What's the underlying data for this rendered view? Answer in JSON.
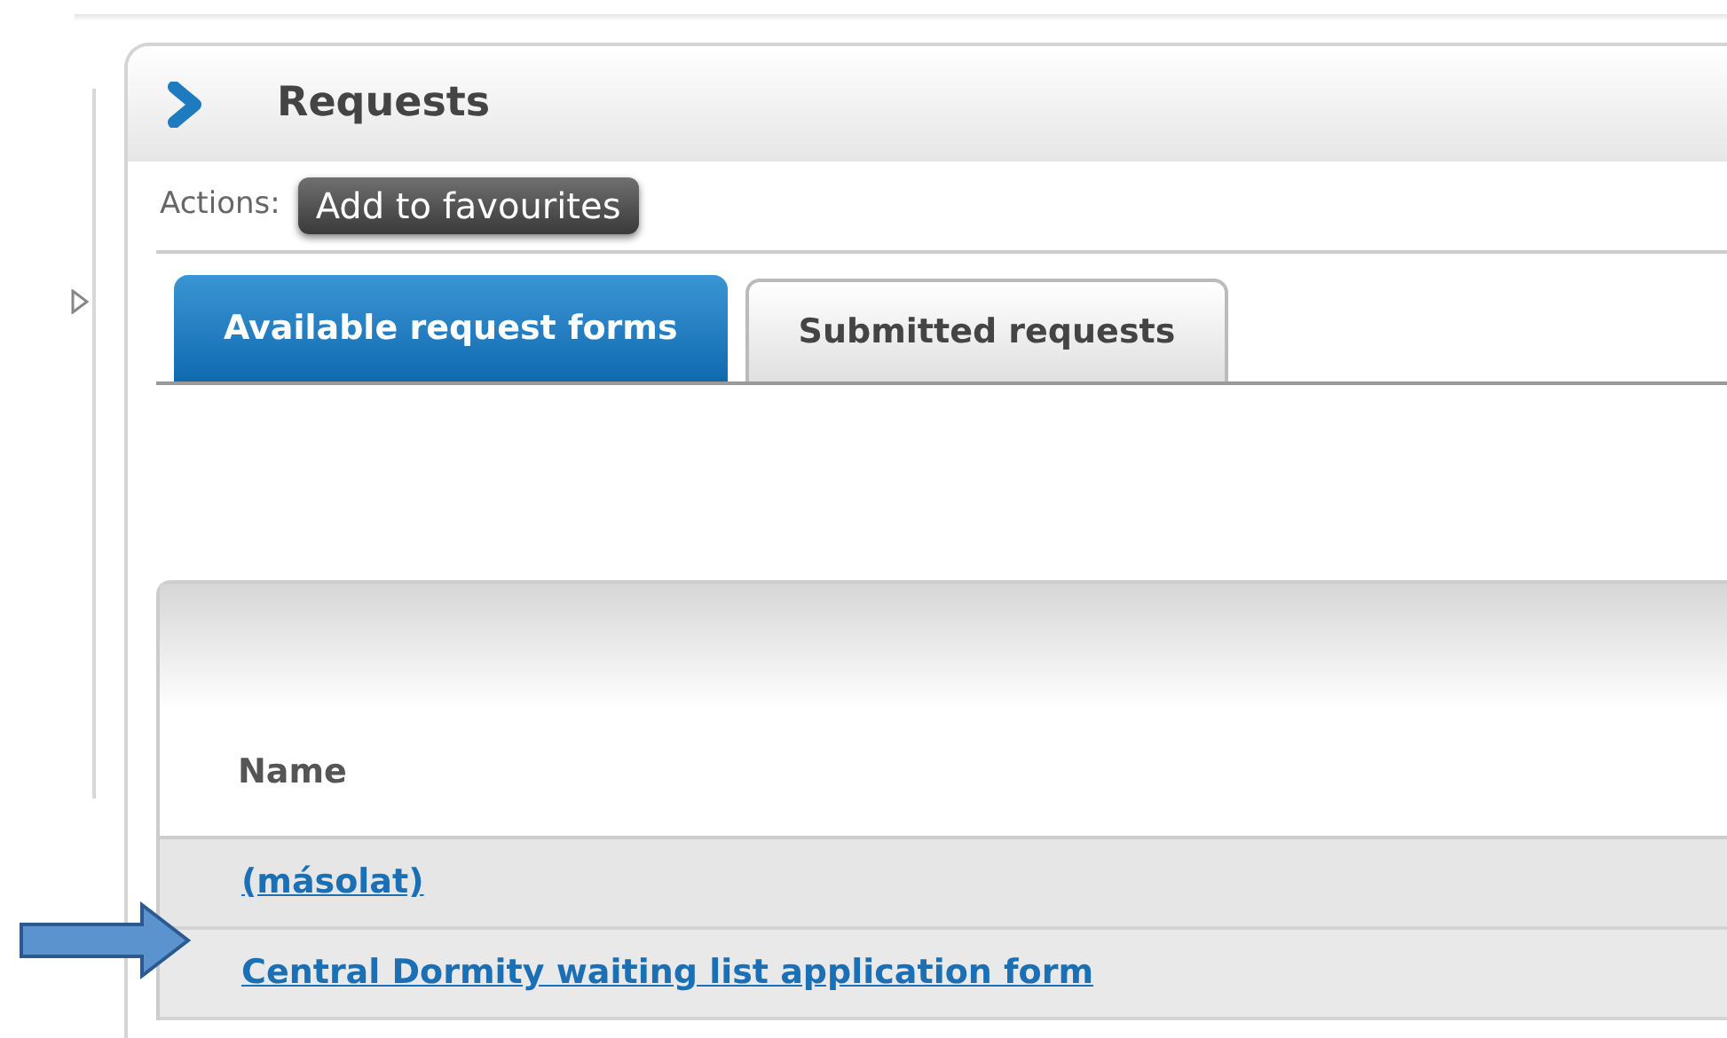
{
  "page": {
    "title": "Requests"
  },
  "actions": {
    "label": "Actions:",
    "buttons": [
      "Add to favourites"
    ]
  },
  "tabs": [
    {
      "label": "Available request forms",
      "selected": true
    },
    {
      "label": "Submitted requests",
      "selected": false
    }
  ],
  "table": {
    "columns": [
      "Name"
    ],
    "rows": [
      {
        "name": "(másolat)",
        "highlighted": false
      },
      {
        "name": "Central Dormity waiting list application form",
        "highlighted": true
      }
    ]
  }
}
